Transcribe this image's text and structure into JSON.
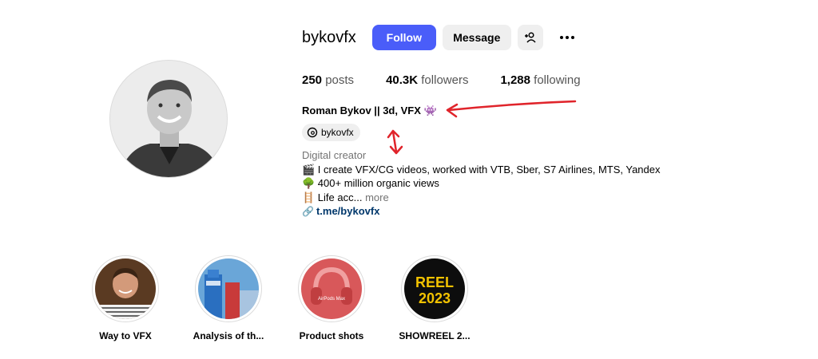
{
  "profile": {
    "username": "bykovfx",
    "follow_label": "Follow",
    "message_label": "Message",
    "stats": [
      {
        "value": "250",
        "label": "posts"
      },
      {
        "value": "40.3K",
        "label": "followers"
      },
      {
        "value": "1,288",
        "label": "following"
      }
    ],
    "full_name": "Roman Bykov || 3d, VFX",
    "name_emoji": "👾",
    "threads_handle": "bykovfx",
    "category": "Digital creator",
    "bio_lines": [
      "🎬 I create VFX/CG videos, worked with VTB, Sber, S7 Airlines, MTS, Yandex",
      "🌳 400+ million organic views",
      "🪜 Life acc..."
    ],
    "more_label": "more",
    "link": "t.me/bykovfx"
  },
  "highlights": [
    {
      "title": "Way to VFX"
    },
    {
      "title": "Analysis of th..."
    },
    {
      "title": "Product shots",
      "cover_text": "AirPods Max"
    },
    {
      "title": "SHOWREEL 2...",
      "cover_text_1": "REEL",
      "cover_text_2": "2023"
    }
  ],
  "colors": {
    "follow_button": "#4a5df9",
    "annotation": "#e0242b",
    "link": "#00376b"
  }
}
